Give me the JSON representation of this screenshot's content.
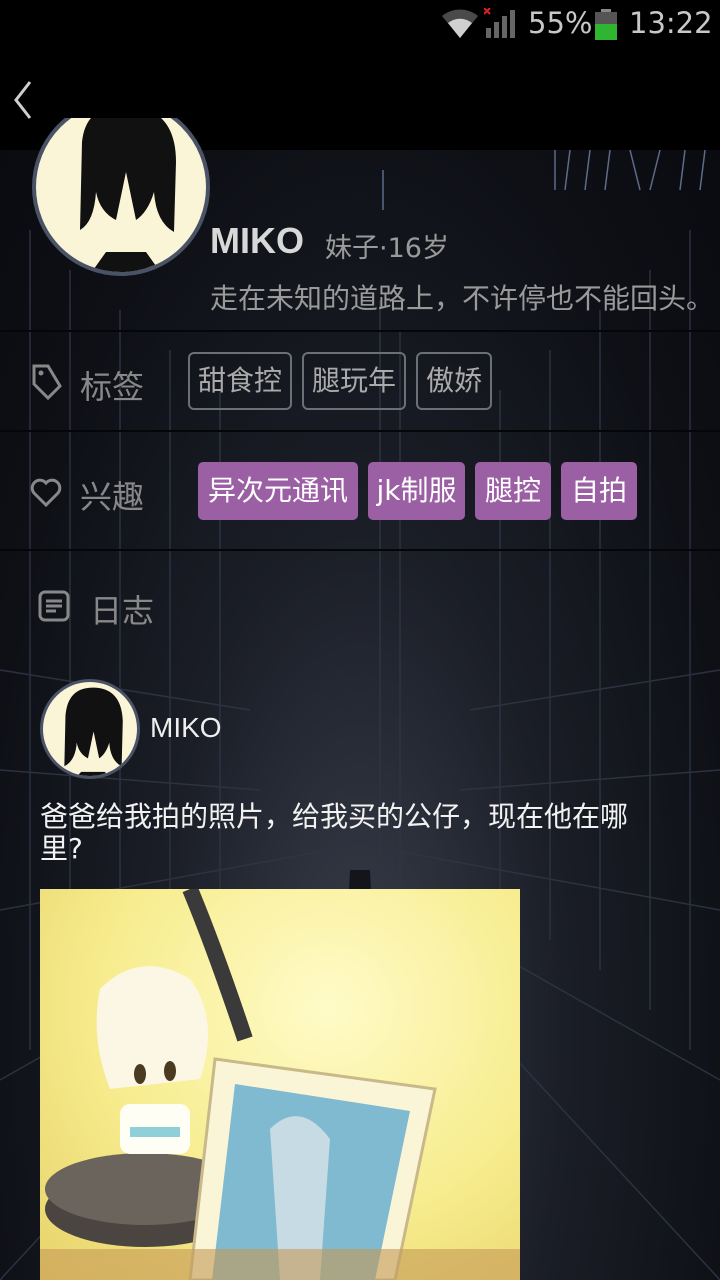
{
  "status_bar": {
    "battery": "55%",
    "time": "13:22",
    "icons": [
      "wifi-icon",
      "signal-icon",
      "battery-icon"
    ]
  },
  "nav": {
    "back_icon": "chevron-left-icon"
  },
  "profile": {
    "name": "MIKO",
    "meta": "妹子·16岁",
    "motto": "走在未知的道路上，不许停也不能回头。"
  },
  "tags_row": {
    "label": "标签",
    "icon": "tag-icon",
    "tags": [
      "甜食控",
      "腿玩年",
      "傲娇"
    ]
  },
  "interests_row": {
    "label": "兴趣",
    "icon": "heart-icon",
    "items": [
      "异次元通讯",
      "jk制服",
      "腿控",
      "自拍"
    ]
  },
  "journal": {
    "label": "日志",
    "icon": "journal-icon",
    "post": {
      "author": "MIKO",
      "text": "爸爸给我拍的照片，给我买的公仔，现在他在哪里?"
    }
  },
  "colors": {
    "interest_bg": "#9b5fa3",
    "tag_border": "#6b6f78",
    "background": "#0e1016"
  }
}
